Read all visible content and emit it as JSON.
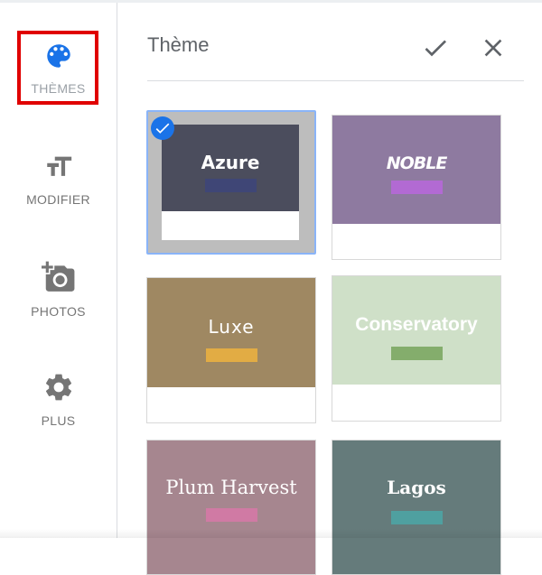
{
  "sidebar": {
    "items": [
      {
        "label": "THÈMES",
        "icon": "palette-icon",
        "selected": true
      },
      {
        "label": "MODIFIER",
        "icon": "text-size-icon",
        "selected": false
      },
      {
        "label": "PHOTOS",
        "icon": "add-photo-icon",
        "selected": false
      },
      {
        "label": "PLUS",
        "icon": "gear-icon",
        "selected": false
      }
    ]
  },
  "panel": {
    "title": "Thème",
    "confirm_icon": "check-icon",
    "close_icon": "close-icon"
  },
  "themes": [
    {
      "name": "Azure",
      "background": "#4b4d5d",
      "accent": "#3f4676",
      "text_color": "#ffffff",
      "selected": true
    },
    {
      "name": "NOBLE",
      "background": "#8e7aa0",
      "accent": "#b26ad3",
      "text_color": "#ffffff",
      "selected": false
    },
    {
      "name": "Luxe",
      "background": "#9f8862",
      "accent": "#e2ac44",
      "text_color": "#ffffff",
      "selected": false
    },
    {
      "name": "Conservatory",
      "background": "#cfe0c8",
      "accent": "#84ad6c",
      "text_color": "#ffffff",
      "selected": false
    },
    {
      "name": "Plum Harvest",
      "background": "#a6868f",
      "accent": "#d07aa4",
      "text_color": "#ffffff",
      "selected": false
    },
    {
      "name": "Lagos",
      "background": "#657b7b",
      "accent": "#4fa0a0",
      "text_color": "#ffffff",
      "selected": false
    }
  ],
  "colors": {
    "accent_blue": "#1a73e8",
    "highlight_red": "#e00000"
  }
}
